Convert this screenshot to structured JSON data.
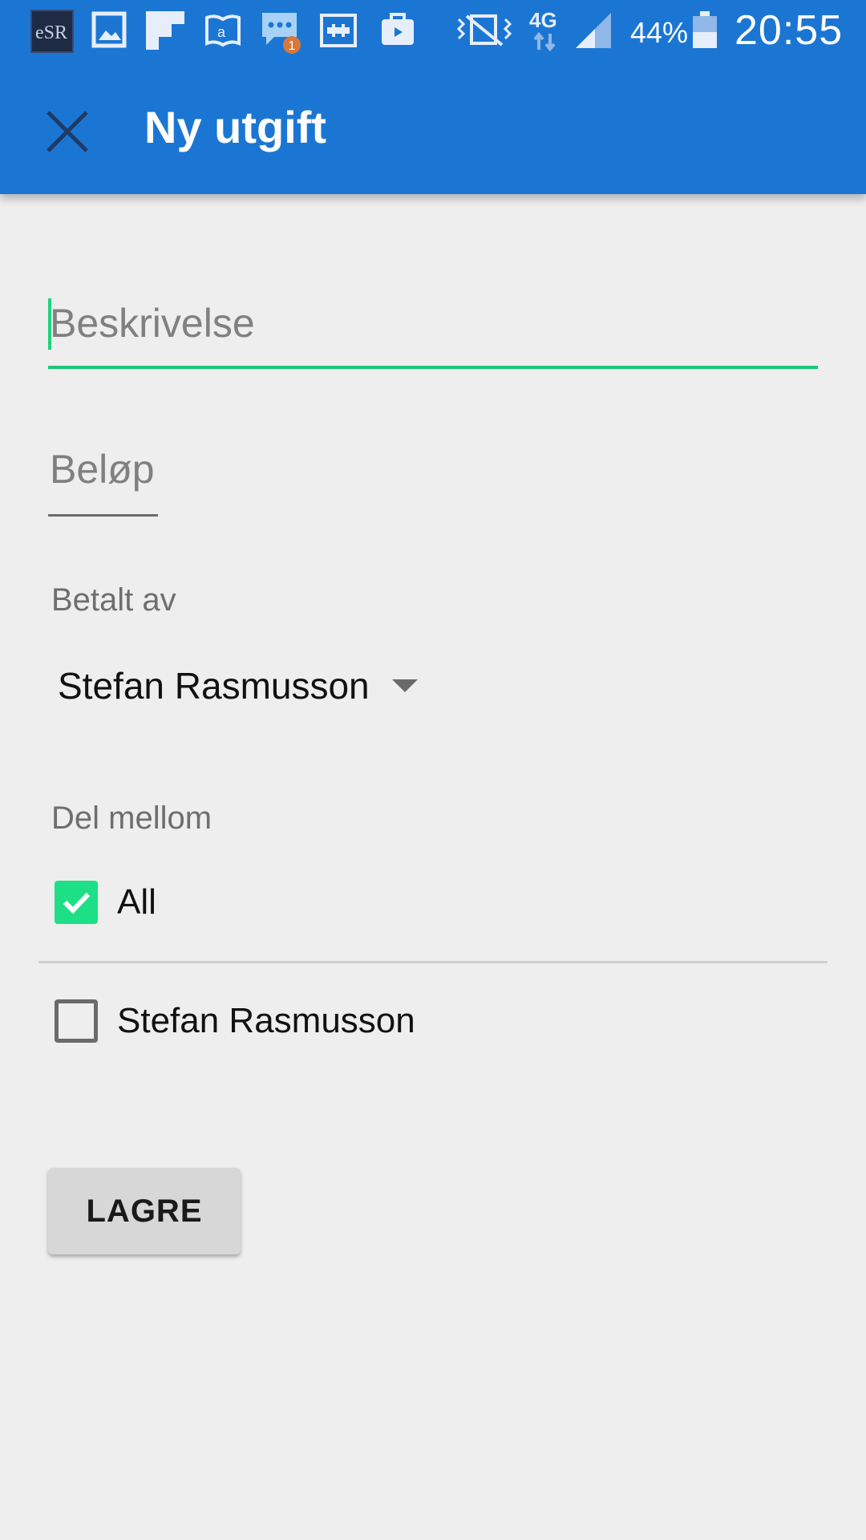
{
  "status_bar": {
    "battery_percent": "44%",
    "time": "20:55",
    "network": "4G",
    "notification_count": "1",
    "icons": [
      "app-icon",
      "gallery-icon",
      "flipboard-icon",
      "amazon-kindle-icon",
      "chat-icon",
      "voicemail-icon",
      "briefcase-icon",
      "vibrate-icon",
      "4g-icon",
      "signal-icon",
      "battery-icon"
    ]
  },
  "toolbar": {
    "title": "Ny utgift",
    "close_icon": "close-icon"
  },
  "form": {
    "description_placeholder": "Beskrivelse",
    "amount_placeholder": "Beløp",
    "paid_by_label": "Betalt av",
    "paid_by_value": "Stefan Rasmusson",
    "split_label": "Del mellom",
    "split_options": [
      {
        "label": "All",
        "checked": true
      },
      {
        "label": "Stefan Rasmusson",
        "checked": false
      }
    ],
    "save_label": "LAGRE"
  },
  "colors": {
    "app_bar": "#1b76d3",
    "accent": "#1de086",
    "background": "#eeeeee"
  }
}
